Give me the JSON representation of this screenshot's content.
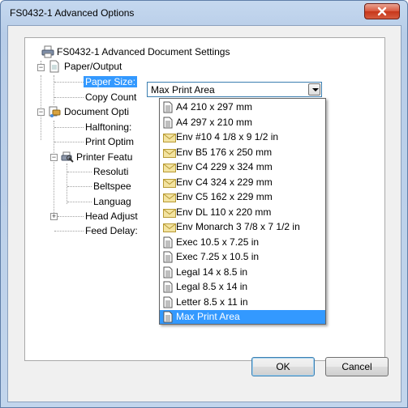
{
  "window": {
    "title": "FS0432-1 Advanced Options"
  },
  "tree": {
    "root": {
      "label": "FS0432-1 Advanced Document Settings",
      "icon": "printer-icon"
    },
    "paper_output": {
      "label": "Paper/Output",
      "icon": "paper-icon"
    },
    "paper_size": {
      "label": "Paper Size:"
    },
    "copy_count": {
      "label": "Copy Count"
    },
    "document_options": {
      "label": "Document Opti",
      "icon": "document-options-icon"
    },
    "halftoning": {
      "label": "Halftoning:"
    },
    "print_optim": {
      "label": "Print Optim"
    },
    "printer_features": {
      "label": "Printer Featu",
      "icon": "printer-features-icon"
    },
    "resolution": {
      "label": "Resoluti"
    },
    "beltspeed": {
      "label": "Beltspee"
    },
    "language": {
      "label": "Languag"
    },
    "head_adjust": {
      "label": "Head Adjust"
    },
    "feed_delay": {
      "label": "Feed Delay:"
    }
  },
  "paper_size_combo": {
    "value": "Max Print Area",
    "options": [
      {
        "label": "A4 210 x 297 mm",
        "icon": "page-icon"
      },
      {
        "label": "A4 297 x 210 mm",
        "icon": "page-icon"
      },
      {
        "label": "Env #10 4 1/8 x 9 1/2 in",
        "icon": "envelope-icon"
      },
      {
        "label": "Env B5 176 x 250 mm",
        "icon": "envelope-icon"
      },
      {
        "label": "Env C4 229 x 324 mm",
        "icon": "envelope-icon"
      },
      {
        "label": "Env C4 324 x 229 mm",
        "icon": "envelope-icon"
      },
      {
        "label": "Env C5 162 x 229 mm",
        "icon": "envelope-icon"
      },
      {
        "label": "Env DL 110 x 220 mm",
        "icon": "envelope-icon"
      },
      {
        "label": "Env Monarch 3 7/8 x 7 1/2 in",
        "icon": "envelope-icon"
      },
      {
        "label": "Exec 10.5 x 7.25 in",
        "icon": "page-icon"
      },
      {
        "label": "Exec 7.25 x 10.5 in",
        "icon": "page-icon"
      },
      {
        "label": "Legal 14 x 8.5 in",
        "icon": "page-icon"
      },
      {
        "label": "Legal 8.5 x 14 in",
        "icon": "page-icon"
      },
      {
        "label": "Letter 8.5 x 11 in",
        "icon": "page-icon"
      },
      {
        "label": "Max Print Area",
        "icon": "page-icon"
      }
    ],
    "selected_index": 14
  },
  "buttons": {
    "ok": "OK",
    "cancel": "Cancel"
  },
  "colors": {
    "selection": "#3399ff",
    "close_button": "#c7361a"
  }
}
